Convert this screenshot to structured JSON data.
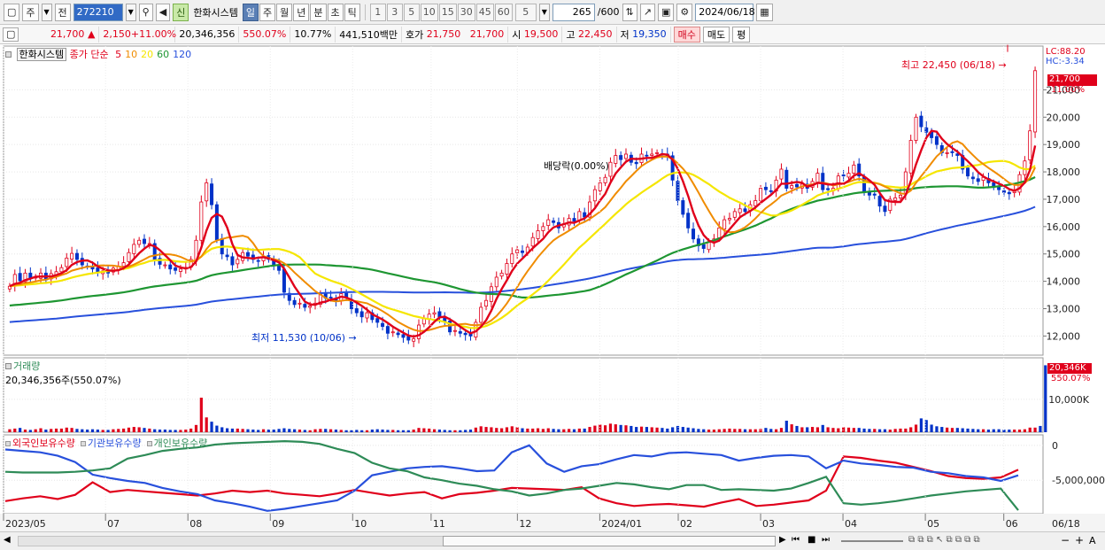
{
  "toolbar": {
    "market_label": "주",
    "prev_label": "전",
    "code": "272210",
    "stock_name": "한화시스템",
    "period_buttons": [
      "일",
      "주",
      "월",
      "년",
      "분",
      "초",
      "틱"
    ],
    "number_buttons": [
      "1",
      "3",
      "5",
      "10",
      "15",
      "30",
      "45",
      "60"
    ],
    "interval": "5",
    "count": "265",
    "count_total": "/600",
    "date": "2024/06/18",
    "new_label": "신"
  },
  "quote": {
    "price": "21,700",
    "arrow": "▲",
    "change": "2,150",
    "change_pct": "+11.00%",
    "volume": "20,346,356",
    "volume_pct": "550.07%",
    "turnover": "10.77%",
    "amount": "441,510백만",
    "bid_label": "호가",
    "ask": "21,750",
    "bid": "21,700",
    "open_label": "시",
    "open": "19,500",
    "high_label": "고",
    "high": "22,450",
    "low_label": "저",
    "low": "19,350",
    "buy_label": "매수",
    "sell_label": "매도",
    "eval_label": "평"
  },
  "price_legend": {
    "name": "한화시스템",
    "type": "종가 단순",
    "ma_labels": [
      "5",
      "10",
      "20",
      "60",
      "120"
    ]
  },
  "volume_legend": {
    "name": "거래량",
    "value": "20,346,356주(550.07%)"
  },
  "holdings_legend": {
    "series": [
      "외국인보유수량",
      "기관보유수량",
      "개인보유수량"
    ]
  },
  "annotations": {
    "high": "최고 22,450 (06/18)",
    "low": "최저 11,530 (10/06)",
    "dividend": "배당락(0.00%)",
    "lc": "LC:88.20",
    "hc": "HC:-3.34",
    "last_price": "21,700",
    "last_pct": "11.00%",
    "vol_last": "20,346K",
    "vol_pct": "550.07%"
  },
  "colors": {
    "up": "#e0001b",
    "down": "#0032c8",
    "ma5": "#e0001b",
    "ma10": "#f08c00",
    "ma20": "#f5e600",
    "ma60": "#1e9632",
    "ma120": "#2850dc",
    "foreign": "#e0001b",
    "institution": "#2850dc",
    "individual": "#2e8b57"
  },
  "chart_data": [
    {
      "type": "candlestick",
      "title": "한화시스템",
      "x_ticks": [
        "2023/05",
        "07",
        "08",
        "09",
        "10",
        "11",
        "12",
        "2024/01",
        "02",
        "03",
        "04",
        "05",
        "06"
      ],
      "x_end_label": "06/18",
      "y_ticks": [
        "12,000",
        "13,000",
        "14,000",
        "15,000",
        "16,000",
        "17,000",
        "18,000",
        "19,000",
        "20,000",
        "21,000"
      ],
      "ylim": [
        11300,
        22600
      ],
      "close": [
        13820,
        14250,
        14020,
        14300,
        14100,
        14150,
        14300,
        14050,
        14280,
        14350,
        14500,
        14850,
        15020,
        14800,
        14600,
        14550,
        14450,
        14320,
        14380,
        14300,
        14480,
        14550,
        14680,
        15050,
        15350,
        15500,
        15380,
        15380,
        14800,
        14620,
        14600,
        14450,
        14400,
        14450,
        14480,
        14800,
        15500,
        16900,
        17600,
        16800,
        15520,
        15000,
        14900,
        14600,
        14800,
        15050,
        14920,
        14800,
        14750,
        14900,
        14800,
        14600,
        14400,
        13600,
        13300,
        13150,
        13200,
        13050,
        13100,
        13200,
        13550,
        13380,
        13400,
        13300,
        13550,
        13400,
        13000,
        12850,
        12700,
        12850,
        12600,
        12500,
        12350,
        12100,
        12150,
        12050,
        11950,
        11850,
        11900,
        12400,
        12650,
        12800,
        12850,
        12700,
        12550,
        12150,
        12200,
        12100,
        12050,
        12000,
        12500,
        13050,
        13300,
        13800,
        14150,
        14300,
        14650,
        15000,
        15150,
        15050,
        15250,
        15600,
        15850,
        16000,
        16250,
        16150,
        15950,
        16100,
        16300,
        16200,
        16550,
        16350,
        16900,
        17350,
        17600,
        17800,
        18350,
        18600,
        18450,
        18650,
        18350,
        18300,
        18650,
        18600,
        18650,
        18700,
        18650,
        18550,
        17700,
        16950,
        16450,
        15950,
        15550,
        15300,
        15200,
        15450,
        15550,
        15950,
        16250,
        16300,
        16550,
        16650,
        16550,
        16800,
        16950,
        17400,
        17350,
        17300,
        17700,
        18100,
        17400,
        17500,
        17450,
        17550,
        17400,
        17650,
        17950,
        17350,
        17350,
        17400,
        17850,
        17850,
        17950,
        18250,
        17850,
        17250,
        17150,
        17150,
        16750,
        16550,
        17000,
        17050,
        17150,
        18000,
        19150,
        20000,
        19650,
        19450,
        19250,
        19000,
        18700,
        18700,
        18700,
        18600,
        18100,
        17850,
        17750,
        17650,
        17800,
        17600,
        17450,
        17350,
        17250,
        17200,
        17300,
        17900,
        18400,
        19500,
        21700
      ]
    },
    {
      "type": "bar",
      "title": "거래량",
      "y_ticks": [
        "10,000K"
      ],
      "ylim": [
        0,
        21000
      ],
      "values_k": [
        900,
        1100,
        1300,
        800,
        700,
        900,
        1200,
        800,
        1000,
        1100,
        1100,
        1400,
        1300,
        1000,
        900,
        800,
        900,
        800,
        700,
        700,
        900,
        1000,
        1100,
        1400,
        1600,
        1500,
        1300,
        1100,
        900,
        800,
        800,
        700,
        700,
        700,
        800,
        1100,
        2200,
        10500,
        4500,
        3200,
        2000,
        1500,
        1200,
        1100,
        1100,
        1000,
        900,
        800,
        700,
        900,
        800,
        800,
        1000,
        1200,
        1000,
        900,
        800,
        700,
        600,
        900,
        1000,
        1000,
        900,
        800,
        700,
        600,
        600,
        700,
        600,
        600,
        800,
        900,
        800,
        700,
        700,
        600,
        600,
        600,
        800,
        1300,
        1200,
        1100,
        900,
        800,
        700,
        600,
        600,
        600,
        700,
        800,
        1400,
        1800,
        1600,
        1500,
        1300,
        1200,
        1500,
        1800,
        1500,
        1200,
        1100,
        1100,
        1200,
        1000,
        1200,
        1000,
        900,
        900,
        1000,
        900,
        1100,
        1100,
        1600,
        2000,
        2300,
        2100,
        2600,
        2400,
        2200,
        2100,
        1900,
        1600,
        1700,
        1600,
        1500,
        1400,
        1300,
        1100,
        1500,
        1900,
        1600,
        1400,
        1200,
        1000,
        900,
        800,
        800,
        900,
        1000,
        1100,
        1000,
        1000,
        900,
        900,
        900,
        1000,
        1300,
        1000,
        900,
        1300,
        3500,
        2400,
        1900,
        1500,
        1500,
        1600,
        1500,
        2200,
        1500,
        1300,
        1200,
        1500,
        1400,
        1300,
        1300,
        1100,
        1000,
        1000,
        900,
        900,
        800,
        1000,
        1100,
        1100,
        1500,
        2300,
        4200,
        3700,
        2300,
        1800,
        1600,
        1400,
        1300,
        1300,
        1200,
        1100,
        1000,
        900,
        900,
        800,
        900,
        900,
        800,
        800,
        800,
        800,
        900,
        1400,
        1400,
        1900,
        20346
      ]
    },
    {
      "type": "line",
      "title": "외국인보유수량 / 기관보유수량 / 개인보유수량",
      "y_ticks": [
        "0",
        "-5,000,000"
      ],
      "series": [
        {
          "name": "외국인보유수량",
          "values": [
            -8000000,
            -7600000,
            -7300000,
            -7700000,
            -7100000,
            -5300000,
            -6700000,
            -6400000,
            -6600000,
            -6800000,
            -7000000,
            -7200000,
            -6900000,
            -6500000,
            -6700000,
            -6500000,
            -6900000,
            -7100000,
            -7300000,
            -6900000,
            -6400000,
            -6800000,
            -7200000,
            -6900000,
            -6700000,
            -7600000,
            -7000000,
            -6800000,
            -6500000,
            -6100000,
            -6200000,
            -6300000,
            -6400000,
            -6000000,
            -7600000,
            -8300000,
            -8700000,
            -8500000,
            -8400000,
            -8600000,
            -8800000,
            -8200000,
            -7700000,
            -8700000,
            -8500000,
            -8200000,
            -7900000,
            -6500000,
            -1600000,
            -1800000,
            -2200000,
            -2500000,
            -3100000,
            -3700000,
            -4400000,
            -4700000,
            -4800000,
            -4600000,
            -3500000
          ]
        },
        {
          "name": "기관보유수량",
          "values": [
            -600000,
            -800000,
            -1000000,
            -1500000,
            -2400000,
            -4200000,
            -4700000,
            -5100000,
            -5400000,
            -6100000,
            -6600000,
            -7000000,
            -7900000,
            -8300000,
            -8800000,
            -9400000,
            -9100000,
            -8700000,
            -8300000,
            -7900000,
            -6500000,
            -4300000,
            -3800000,
            -3300000,
            -3100000,
            -3000000,
            -3300000,
            -3700000,
            -3600000,
            -1000000,
            0,
            -2600000,
            -3800000,
            -3000000,
            -2700000,
            -2000000,
            -1400000,
            -1600000,
            -1100000,
            -1000000,
            -1200000,
            -1400000,
            -2200000,
            -1800000,
            -1500000,
            -1400000,
            -1600000,
            -3300000,
            -2200000,
            -2600000,
            -2800000,
            -3100000,
            -3200000,
            -3800000,
            -4000000,
            -4400000,
            -4600000,
            -5100000,
            -4300000
          ]
        },
        {
          "name": "개인보유수량",
          "values": [
            -3800000,
            -3900000,
            -3900000,
            -3900000,
            -3800000,
            -3600000,
            -3300000,
            -1900000,
            -1400000,
            -800000,
            -500000,
            -300000,
            100000,
            300000,
            400000,
            500000,
            600000,
            500000,
            200000,
            -500000,
            -1100000,
            -2500000,
            -3300000,
            -3700000,
            -4600000,
            -5000000,
            -5500000,
            -5800000,
            -6300000,
            -6600000,
            -7200000,
            -6900000,
            -6400000,
            -6200000,
            -5800000,
            -5400000,
            -5600000,
            -6000000,
            -6300000,
            -5700000,
            -5700000,
            -6400000,
            -6300000,
            -6400000,
            -6500000,
            -6200000,
            -5400000,
            -4500000,
            -8300000,
            -8500000,
            -8300000,
            -8000000,
            -7600000,
            -7200000,
            -6900000,
            -6600000,
            -6400000,
            -6200000,
            -9300000
          ]
        }
      ]
    }
  ]
}
